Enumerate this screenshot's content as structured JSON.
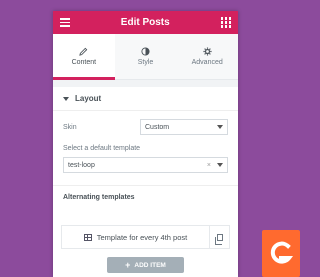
{
  "header": {
    "title": "Edit Posts"
  },
  "tabs": [
    {
      "label": "Content",
      "icon": "pencil-icon",
      "active": true
    },
    {
      "label": "Style",
      "icon": "contrast-icon",
      "active": false
    },
    {
      "label": "Advanced",
      "icon": "gear-icon",
      "active": false
    }
  ],
  "section": {
    "title": "Layout"
  },
  "skin": {
    "label": "Skin",
    "value": "Custom"
  },
  "template": {
    "label": "Select a default template",
    "value": "test-loop"
  },
  "alternating": {
    "title": "Alternating templates"
  },
  "repeater_item": {
    "label": "Template for every 4th post"
  },
  "add_item": {
    "label": "ADD ITEM"
  },
  "colors": {
    "accent": "#d3215e",
    "background": "#8c4b9c",
    "logo": "#ff6a2f"
  }
}
